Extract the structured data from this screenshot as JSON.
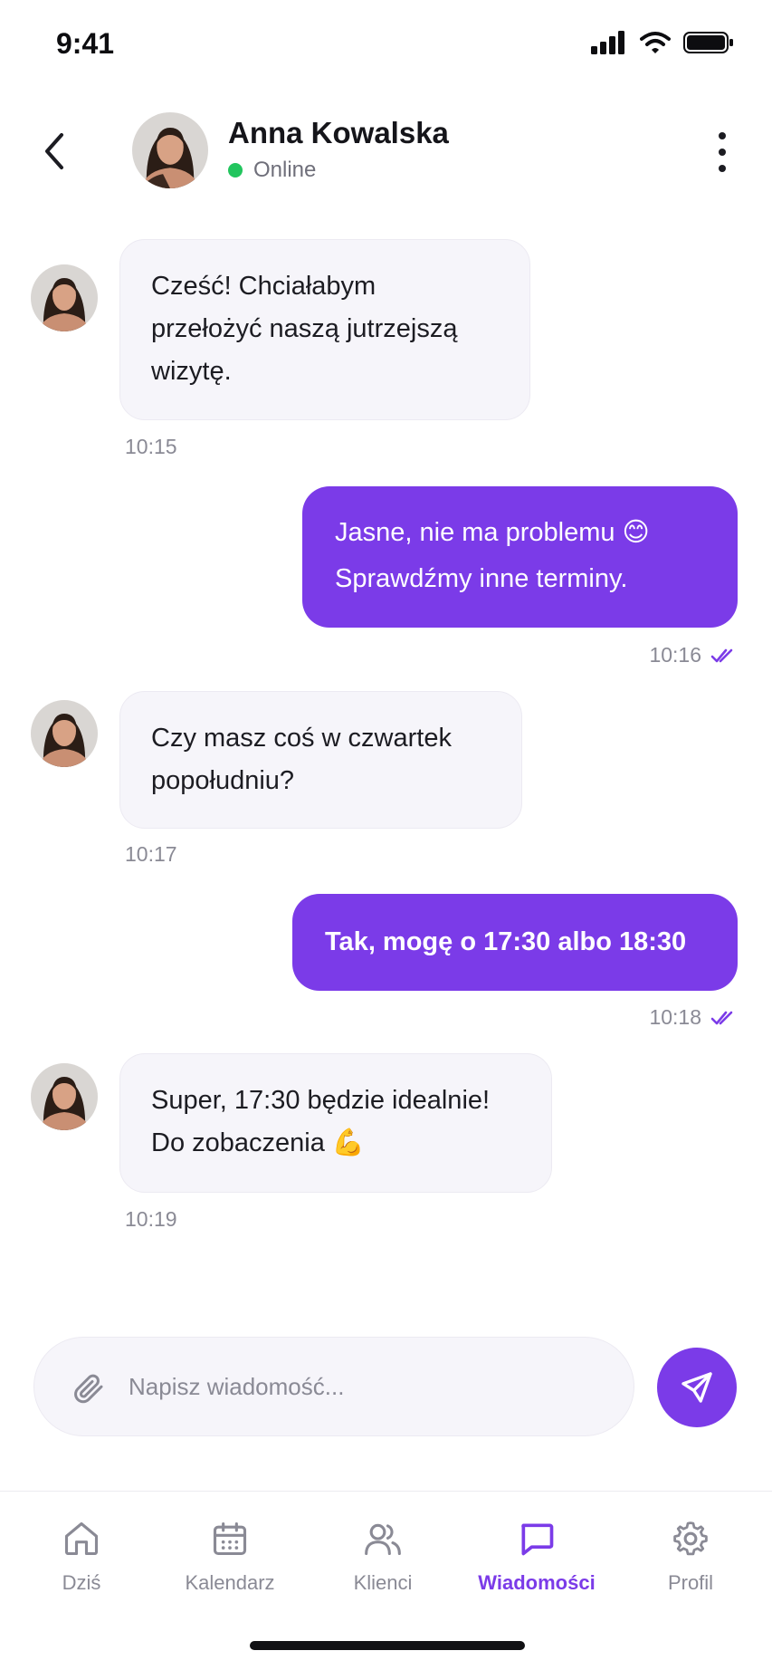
{
  "status_bar": {
    "time": "9:41"
  },
  "header": {
    "contact_name": "Anna Kowalska",
    "presence": "Online"
  },
  "messages": [
    {
      "direction": "in",
      "lines": [
        "Cześć! Chciałabym",
        "przełożyć naszą jutrzejszą",
        "wizytę."
      ],
      "time": "10:15"
    },
    {
      "direction": "out",
      "lines": [
        "Jasne, nie ma problemu 😊",
        "Sprawdźmy inne terminy."
      ],
      "time": "10:16",
      "read": true
    },
    {
      "direction": "in",
      "lines": [
        "Czy masz coś w czwartek",
        "popołudniu?"
      ],
      "time": "10:17"
    },
    {
      "direction": "out",
      "lines": [
        "Tak, mogę o 17:30 albo 18:30"
      ],
      "time": "10:18",
      "read": true
    },
    {
      "direction": "in",
      "lines": [
        "Super, 17:30 będzie idealnie!",
        "Do zobaczenia 💪"
      ],
      "time": "10:19"
    }
  ],
  "composer": {
    "placeholder": "Napisz wiadomość..."
  },
  "tabs": [
    {
      "label": "Dziś",
      "icon": "home-icon"
    },
    {
      "label": "Kalendarz",
      "icon": "calendar-icon"
    },
    {
      "label": "Klienci",
      "icon": "users-icon"
    },
    {
      "label": "Wiadomości",
      "icon": "chat-icon",
      "active": true
    },
    {
      "label": "Profil",
      "icon": "gear-icon"
    }
  ],
  "colors": {
    "accent": "#7b3be8",
    "online": "#22c55e",
    "incoming_bubble": "#f6f5fa"
  }
}
